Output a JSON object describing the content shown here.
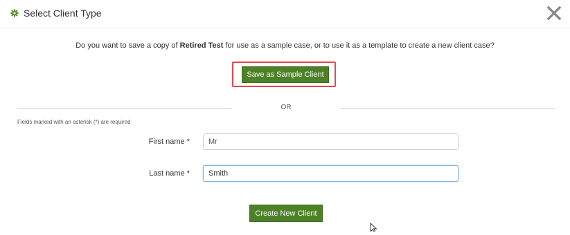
{
  "dialog": {
    "title": "Select Client Type",
    "header_icon": "gear-icon",
    "close_icon": "close-icon"
  },
  "prompt": {
    "before": "Do you want to save a copy of ",
    "client_name": "Retired Test",
    "after": " for use as a sample case, or to use it as a template to create a new client case?"
  },
  "sample_button": {
    "label": "Save as Sample Client"
  },
  "divider": {
    "label": "OR"
  },
  "form": {
    "required_note": "Fields marked with an asterisk (*) are required",
    "first_name": {
      "label": "First name *",
      "value": "Mr"
    },
    "last_name": {
      "label": "Last name *",
      "value": "Smith"
    }
  },
  "create_button": {
    "label": "Create New Client"
  },
  "colors": {
    "button_green": "#4d8127",
    "highlight_red": "#e4474d",
    "gear_green": "#5a8a2c",
    "focus_blue": "#7fb4e6"
  }
}
